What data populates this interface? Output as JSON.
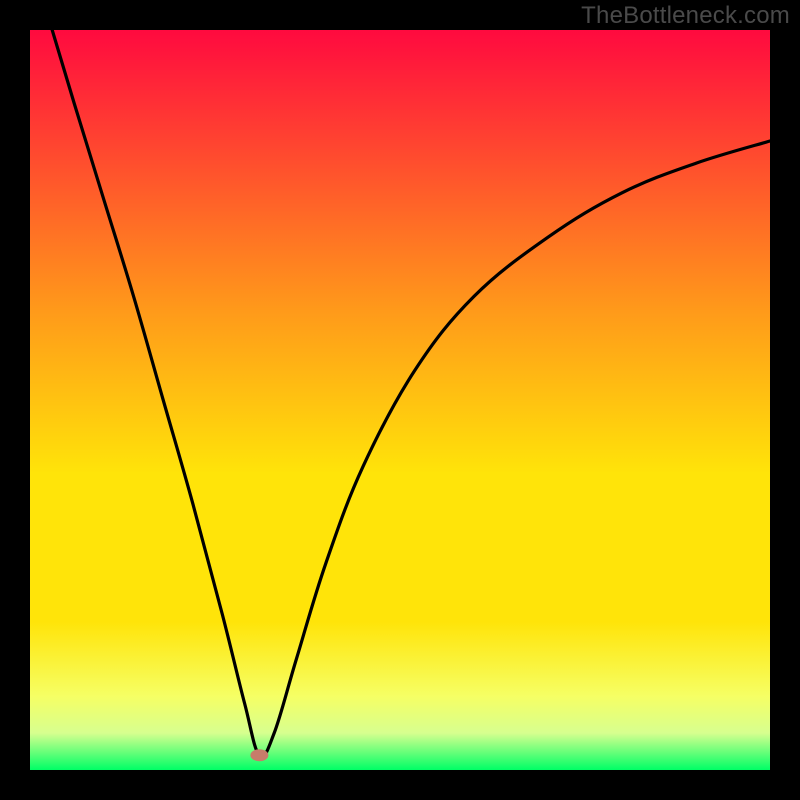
{
  "watermark": "TheBottleneck.com",
  "colors": {
    "frame": "#000000",
    "curve": "#000000",
    "marker_fill": "#c77c6a",
    "grad_top": "#ff0a3f",
    "grad_mid_upper": "#ff9a1a",
    "grad_mid": "#ffe409",
    "grad_lower": "#f6ff64",
    "grad_band": "#d7ff8f",
    "grad_bottom": "#00ff66"
  },
  "chart_data": {
    "type": "line",
    "title": "",
    "xlabel": "",
    "ylabel": "",
    "xlim": [
      0,
      100
    ],
    "ylim": [
      0,
      100
    ],
    "minimum_point": {
      "x": 31,
      "y": 2
    },
    "series": [
      {
        "name": "bottleneck-curve",
        "points": [
          {
            "x": 3,
            "y": 100
          },
          {
            "x": 6,
            "y": 90
          },
          {
            "x": 10,
            "y": 77
          },
          {
            "x": 14,
            "y": 64
          },
          {
            "x": 18,
            "y": 50
          },
          {
            "x": 22,
            "y": 36
          },
          {
            "x": 26,
            "y": 21
          },
          {
            "x": 29,
            "y": 9
          },
          {
            "x": 31,
            "y": 2
          },
          {
            "x": 33,
            "y": 5
          },
          {
            "x": 36,
            "y": 15
          },
          {
            "x": 40,
            "y": 28
          },
          {
            "x": 45,
            "y": 41
          },
          {
            "x": 52,
            "y": 54
          },
          {
            "x": 60,
            "y": 64
          },
          {
            "x": 70,
            "y": 72
          },
          {
            "x": 80,
            "y": 78
          },
          {
            "x": 90,
            "y": 82
          },
          {
            "x": 100,
            "y": 85
          }
        ]
      }
    ]
  }
}
